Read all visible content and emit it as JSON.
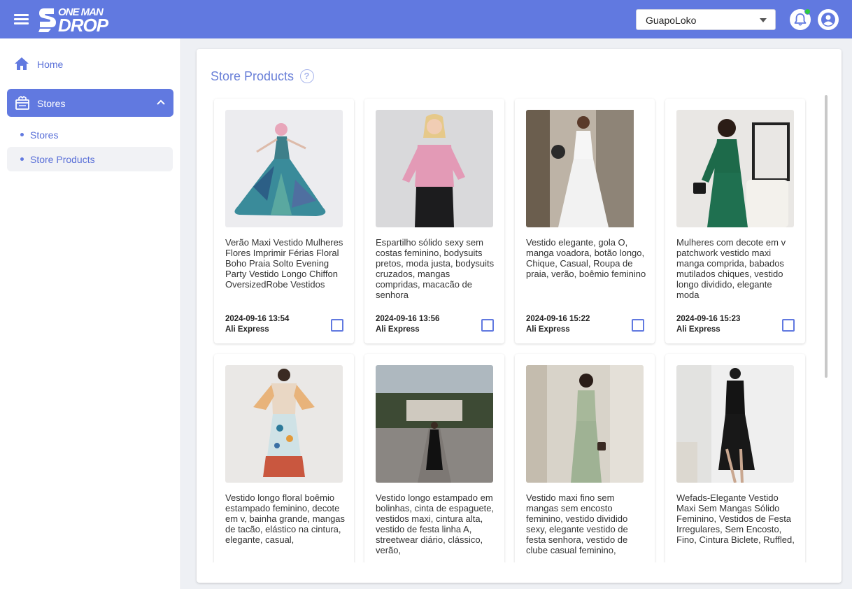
{
  "header": {
    "logo_line1": "ONE MAN",
    "logo_line2": "DROP",
    "store_selector": "GuapoLoko"
  },
  "colors": {
    "primary": "#6179e0",
    "notification_dot": "#2ecc40"
  },
  "sidebar": {
    "home_label": "Home",
    "stores_group_label": "Stores",
    "sub_items": [
      "Stores",
      "Store Products"
    ]
  },
  "main": {
    "title": "Store Products"
  },
  "products": [
    {
      "title": "Verão Maxi Vestido Mulheres Flores Imprimir Férias Floral Boho Praia Solto Evening Party Vestido Longo Chiffon OversizedRobe Vestidos",
      "date": "2024-09-16 13:54",
      "source": "Ali Express"
    },
    {
      "title": "Espartilho sólido sexy sem costas feminino, bodysuits pretos, moda justa, bodysuits cruzados, mangas compridas, macacão de senhora",
      "date": "2024-09-16 13:56",
      "source": "Ali Express"
    },
    {
      "title": "Vestido elegante, gola O, manga voadora, botão longo, Chique, Casual, Roupa de praia, verão, boêmio feminino",
      "date": "2024-09-16 15:22",
      "source": "Ali Express"
    },
    {
      "title": "Mulheres com decote em v patchwork vestido maxi manga comprida, babados mutilados chiques, vestido longo dividido, elegante moda",
      "date": "2024-09-16 15:23",
      "source": "Ali Express"
    },
    {
      "title": "Vestido longo floral boêmio estampado feminino, decote em v, bainha grande, mangas de tacão, elástico na cintura, elegante, casual,",
      "date": "",
      "source": ""
    },
    {
      "title": "Vestido longo estampado em bolinhas, cinta de espaguete, vestidos maxi, cintura alta, vestido de festa linha A, streetwear diário, clássico, verão,",
      "date": "",
      "source": ""
    },
    {
      "title": "Vestido maxi fino sem mangas sem encosto feminino, vestido dividido sexy, elegante vestido de festa senhora, vestido de clube casual feminino,",
      "date": "",
      "source": ""
    },
    {
      "title": "Wefads-Elegante Vestido Maxi Sem Mangas Sólido Feminino, Vestidos de Festa Irregulares, Sem Encosto, Fino, Cintura Biclete, Ruffled,",
      "date": "",
      "source": ""
    }
  ]
}
